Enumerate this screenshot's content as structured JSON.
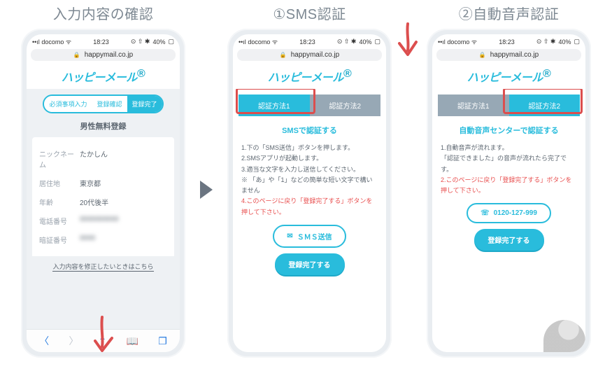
{
  "sections": {
    "s1_title": "入力内容の確認",
    "s2_title": "①SMS認証",
    "s3_title": "②自動音声認証"
  },
  "status": {
    "carrier": "docomo",
    "wifi": "ᯤ",
    "time": "18:23",
    "battery": "40%",
    "ind": "⊙ ⇧ ✱"
  },
  "browser": {
    "lock": "🔒",
    "host": "happymail.co.jp"
  },
  "logo": {
    "text": "ハッピーメール",
    "dot": "®"
  },
  "phone1": {
    "steps": [
      "必須事項入力",
      "登録確認",
      "登録完了"
    ],
    "step_active": 2,
    "heading": "男性無料登録",
    "fields": [
      {
        "k": "ニックネーム",
        "v": "たかしん",
        "blur": false
      },
      {
        "k": "居住地",
        "v": "東京都",
        "blur": false
      },
      {
        "k": "年齢",
        "v": "20代後半",
        "blur": false
      },
      {
        "k": "電話番号",
        "v": "0000000000",
        "blur": true
      },
      {
        "k": "暗証番号",
        "v": "0000",
        "blur": true
      }
    ],
    "edit_text": "入力内容を修正したいときはこちら",
    "safari": {
      "back": "〈",
      "fwd": "〉",
      "share": "⇧",
      "book": "📖",
      "tabs": "❐"
    }
  },
  "phone2": {
    "tabs": [
      "認証方法1",
      "認証方法2"
    ],
    "tab_active": 0,
    "heading": "SMSで認証する",
    "lines": [
      {
        "t": "1.下の「SMS送信」ボタンを押します。",
        "red": false
      },
      {
        "t": "2.SMSアプリが起動します。",
        "red": false
      },
      {
        "t": "3.適当な文字を入力し送信してください。",
        "red": false
      },
      {
        "t": "※ 「あ」や「1」などの簡単な短い文字で構いません",
        "red": false
      },
      {
        "t": "4.このページに戻り「登録完了する」ボタンを押して下さい。",
        "red": true
      }
    ],
    "btn_outline": "ＳＭＳ送信",
    "btn_outline_icon": "✉",
    "btn_fill": "登録完了する"
  },
  "phone3": {
    "tabs": [
      "認証方法1",
      "認証方法2"
    ],
    "tab_active": 1,
    "heading": "自動音声センターで認証する",
    "lines": [
      {
        "t": "1.自動音声が流れます。",
        "red": false
      },
      {
        "t": "「認証できました」の音声が流れたら完了です。",
        "red": false
      },
      {
        "t": "2.このページに戻り「登録完了する」ボタンを押して下さい。",
        "red": true
      }
    ],
    "btn_outline": "0120-127-999",
    "btn_outline_icon": "☏",
    "btn_fill": "登録完了する"
  }
}
